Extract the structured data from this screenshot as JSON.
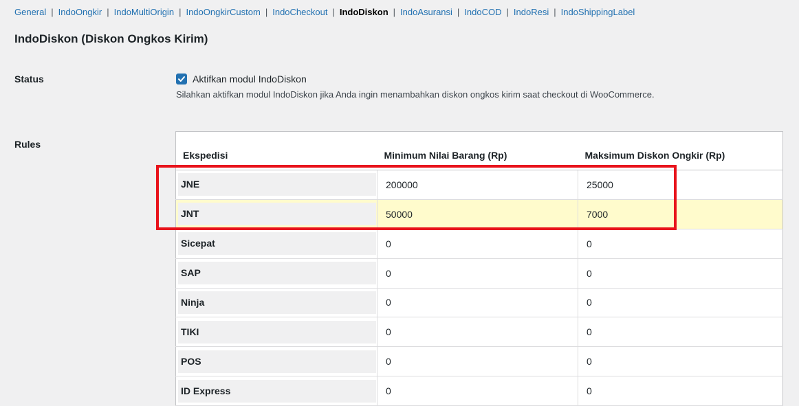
{
  "nav": {
    "tabs": [
      {
        "label": "General",
        "current": false
      },
      {
        "label": "IndoOngkir",
        "current": false
      },
      {
        "label": "IndoMultiOrigin",
        "current": false
      },
      {
        "label": "IndoOngkirCustom",
        "current": false
      },
      {
        "label": "IndoCheckout",
        "current": false
      },
      {
        "label": "IndoDiskon",
        "current": true
      },
      {
        "label": "IndoAsuransi",
        "current": false
      },
      {
        "label": "IndoCOD",
        "current": false
      },
      {
        "label": "IndoResi",
        "current": false
      },
      {
        "label": "IndoShippingLabel",
        "current": false
      }
    ],
    "separator": "|"
  },
  "page_title": "IndoDiskon (Diskon Ongkos Kirim)",
  "status": {
    "label": "Status",
    "checkbox_label": "Aktifkan modul IndoDiskon",
    "checked": true,
    "description": "Silahkan aktifkan modul IndoDiskon jika Anda ingin menambahkan diskon ongkos kirim saat checkout di WooCommerce."
  },
  "rules": {
    "label": "Rules",
    "headers": [
      "Ekspedisi",
      "Minimum Nilai Barang (Rp)",
      "Maksimum Diskon Ongkir (Rp)"
    ],
    "rows": [
      {
        "courier": "JNE",
        "min": "200000",
        "max": "25000"
      },
      {
        "courier": "JNT",
        "min": "50000",
        "max": "7000"
      },
      {
        "courier": "Sicepat",
        "min": "0",
        "max": "0"
      },
      {
        "courier": "SAP",
        "min": "0",
        "max": "0"
      },
      {
        "courier": "Ninja",
        "min": "0",
        "max": "0"
      },
      {
        "courier": "TIKI",
        "min": "0",
        "max": "0"
      },
      {
        "courier": "POS",
        "min": "0",
        "max": "0"
      },
      {
        "courier": "ID Express",
        "min": "0",
        "max": "0"
      }
    ]
  },
  "colors": {
    "accent": "#2271b1",
    "highlight_row": "#fffbcc",
    "annotation_box": "#e8131b"
  }
}
